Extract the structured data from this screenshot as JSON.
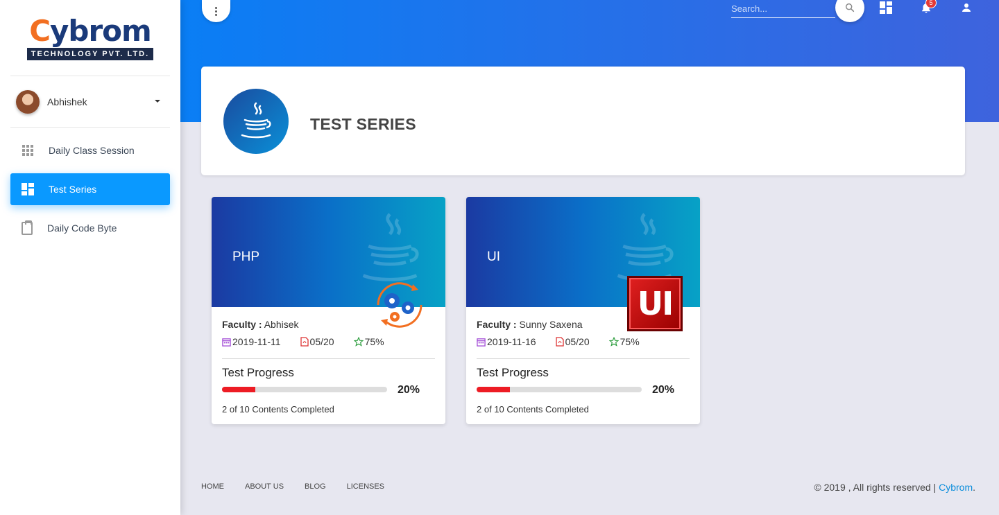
{
  "brand": {
    "word_lead": "C",
    "word_rest": "ybrom",
    "tagline": "TECHNOLOGY PVT. LTD."
  },
  "user": {
    "name": "Abhishek"
  },
  "sidebar": {
    "items": [
      {
        "label": "Daily Class Session",
        "icon": "apps-grid-icon",
        "active": false
      },
      {
        "label": "Test Series",
        "icon": "dashboard-icon",
        "active": true
      },
      {
        "label": "Daily Code Byte",
        "icon": "clipboard-icon",
        "active": false
      }
    ]
  },
  "header": {
    "search_placeholder": "Search...",
    "notification_count": "5",
    "accent": "#0a7ef5"
  },
  "banner": {
    "title": "TEST SERIES",
    "icon": "java-cup-icon"
  },
  "cards": [
    {
      "title": "PHP",
      "faculty_label": "Faculty :",
      "faculty": "Abhisek",
      "date": "2019-11-11",
      "tests": "05/20",
      "rating": "75%",
      "progress_title": "Test Progress",
      "progress_pct": "20%",
      "progress_value": 20,
      "progress_caption": "2 of 10 Contents Completed",
      "image": "gears-icon"
    },
    {
      "title": "UI",
      "faculty_label": "Faculty :",
      "faculty": "Sunny Saxena",
      "date": "2019-11-16",
      "tests": "05/20",
      "rating": "75%",
      "progress_title": "Test Progress",
      "progress_pct": "20%",
      "progress_value": 20,
      "progress_caption": "2 of 10 Contents Completed",
      "image": "ui-logo-icon",
      "image_text": "UI"
    }
  ],
  "footer": {
    "links": [
      "HOME",
      "ABOUT US",
      "BLOG",
      "LICENSES"
    ],
    "copyright": "© 2019 , All rights reserved |",
    "brand": "Cybrom",
    "period": "."
  }
}
